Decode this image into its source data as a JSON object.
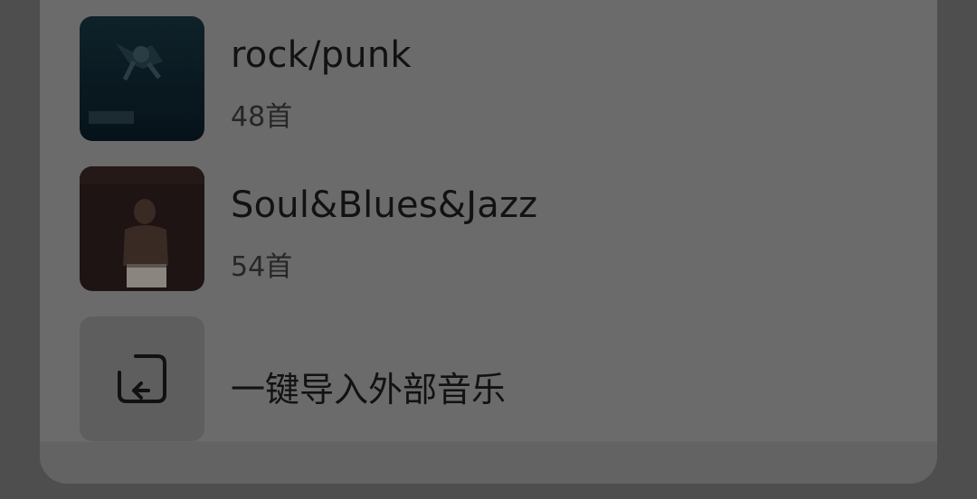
{
  "playlists": [
    {
      "title": "rock/punk",
      "count": "48首",
      "cover_icon": "album-cover-underwater"
    },
    {
      "title": "Soul&Blues&Jazz",
      "count": "54首",
      "cover_icon": "album-cover-portrait"
    }
  ],
  "import": {
    "label": "一键导入外部音乐",
    "icon": "import-arrow-icon"
  }
}
